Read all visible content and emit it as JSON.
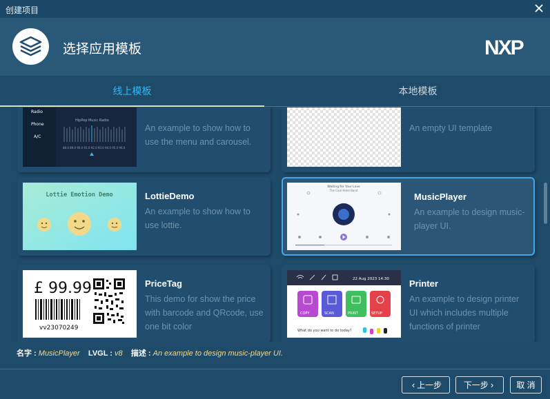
{
  "window": {
    "title": "创建项目",
    "close_label": "close"
  },
  "header": {
    "title": "选择应用模板",
    "logo_text": "NXP"
  },
  "tabs": [
    {
      "label": "线上模板"
    },
    {
      "label": "本地模板"
    }
  ],
  "cards": [
    {
      "name": "",
      "desc": "An example to show how to use the menu and carousel.",
      "thumb": {
        "menu": [
          "Radio",
          "Phone",
          "A/C"
        ],
        "header": "HipPop Music Radio",
        "freqs": "88.0 89.0 90.0 91.0 92.0 93.0 94.0 95.0 96.0"
      }
    },
    {
      "name": "",
      "desc": "An empty UI template"
    },
    {
      "name": "LottieDemo",
      "desc": "An example to show how to use lottie.",
      "thumb": {
        "title": "Lottie Emotion Demo"
      }
    },
    {
      "name": "MusicPlayer",
      "desc": "An example to design music-player UI.",
      "thumb": {
        "song": "Waiting for Your Love",
        "artist": "The Cool Hotel Band"
      }
    },
    {
      "name": "PriceTag",
      "desc": "This demo for show the price with barcode and QRcode, use one bit color",
      "thumb": {
        "price": "£ 99.99",
        "code": "vv23070249"
      }
    },
    {
      "name": "Printer",
      "desc": "An example to design printer UI which includes multiple functions of printer",
      "thumb": {
        "date": "22 Aug 2023 14:30",
        "buttons": [
          "COPY",
          "SCAN",
          "PRINT",
          "SETUP"
        ],
        "question": "What do you want to do today?"
      }
    }
  ],
  "info": {
    "name_key": "名字 : ",
    "name_val": "MusicPlayer",
    "lvgl_key": "LVGL : ",
    "lvgl_val": "v8",
    "desc_key": "描述 : ",
    "desc_val": "An example to design music-player UI."
  },
  "buttons": {
    "prev": "上一步",
    "next": "下一步",
    "cancel": "取 消"
  },
  "colors": {
    "accent": "#38b4ef",
    "selected_border": "#49a7e6",
    "info_value": "#f2d98a"
  }
}
